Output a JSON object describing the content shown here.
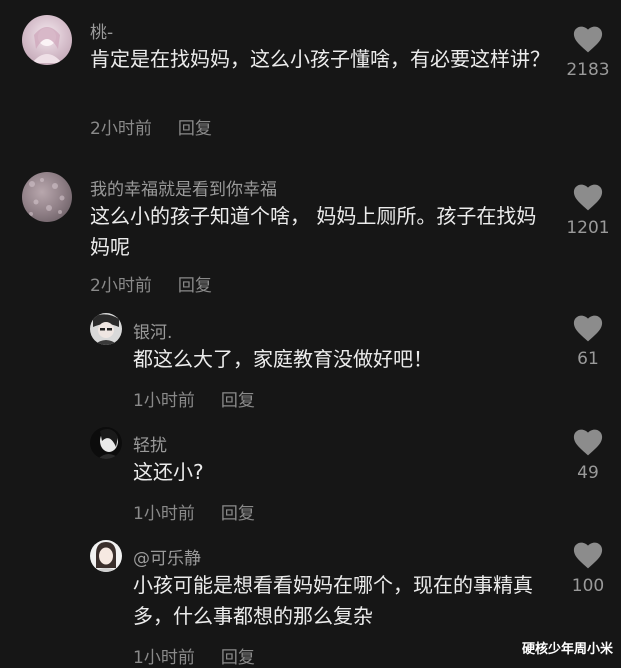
{
  "comments": [
    {
      "username": "桃-",
      "text": "肯定是在找妈妈，这么小孩子懂啥，有必要这样讲？",
      "time": "2小时前",
      "reply_label": "回复",
      "likes": "2183"
    },
    {
      "username": "我的幸福就是看到你幸福",
      "text": "这么小的孩子知道个啥， 妈妈上厕所。孩子在找妈妈呢",
      "time": "2小时前",
      "reply_label": "回复",
      "likes": "1201"
    },
    {
      "username": "银河.",
      "text": "都这么大了，家庭教育没做好吧！",
      "time": "1小时前",
      "reply_label": "回复",
      "likes": "61"
    },
    {
      "username": "轻扰",
      "text": "这还小?",
      "time": "1小时前",
      "reply_label": "回复",
      "likes": "49"
    },
    {
      "username": "@可乐静",
      "text": "小孩可能是想看看妈妈在哪个，现在的事精真多，什么事都想的那么复杂",
      "time": "1小时前",
      "reply_label": "回复",
      "likes": "100"
    }
  ],
  "watermark": "硬核少年周小米",
  "colors": {
    "background": "#161616",
    "text": "#ececec",
    "muted": "#9a9a9a",
    "heart": "#8c8c8c"
  }
}
